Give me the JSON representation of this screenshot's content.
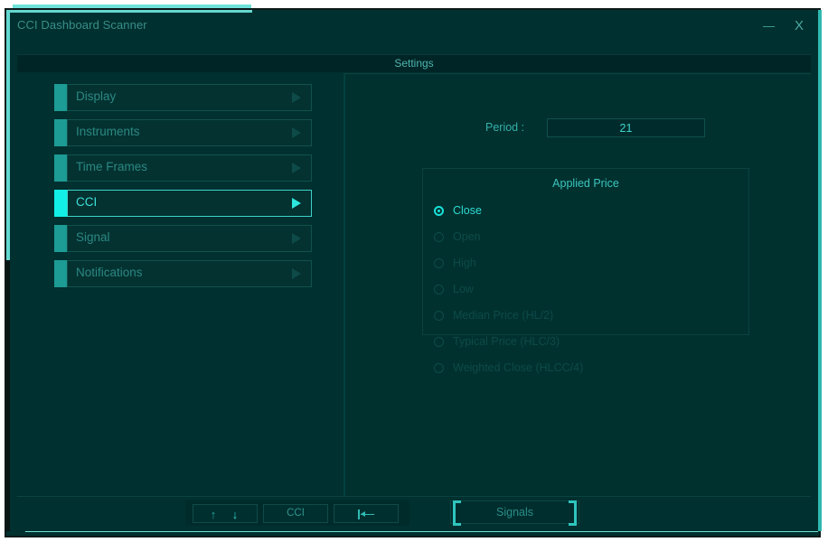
{
  "window": {
    "title": "CCI Dashboard Scanner",
    "minimize_label": "—",
    "close_label": "X"
  },
  "header": {
    "title": "Settings"
  },
  "sidebar": {
    "items": [
      {
        "label": "Display",
        "active": false,
        "arrow": "▶"
      },
      {
        "label": "Instruments",
        "active": false,
        "arrow": "▶"
      },
      {
        "label": "Time Frames",
        "active": false,
        "arrow": "▶"
      },
      {
        "label": "CCI",
        "active": true,
        "arrow": "▶"
      },
      {
        "label": "Signal",
        "active": false,
        "arrow": "▶"
      },
      {
        "label": "Notifications",
        "active": false,
        "arrow": "▶"
      }
    ]
  },
  "settings": {
    "period": {
      "label": "Period :",
      "value": "21",
      "placeholder": "21"
    },
    "applied_price": {
      "title": "Applied Price",
      "selected": "Close",
      "options": [
        {
          "label": "Close",
          "selected": true
        },
        {
          "label": "Open",
          "selected": false
        },
        {
          "label": "High",
          "selected": false
        },
        {
          "label": "Low",
          "selected": false
        },
        {
          "label": "Median Price (HL/2)",
          "selected": false
        },
        {
          "label": "Typical Price (HLC/3)",
          "selected": false
        },
        {
          "label": "Weighted Close (HLCC/4)",
          "selected": false
        }
      ]
    }
  },
  "bottom_bar": {
    "scroll_up_label": "↑",
    "scroll_down_label": "↓",
    "indicator_label": "CCI",
    "collapse_label": "",
    "signals_label": "Signals"
  },
  "colors": {
    "background": "#00302f",
    "accent_bright": "#12efe6",
    "accent_dim": "#1d9b95",
    "text_bright": "#3ce0d8",
    "text_dim": "#2c8882",
    "text_disabled": "#0d4a48",
    "frame": "#63d8d0"
  }
}
